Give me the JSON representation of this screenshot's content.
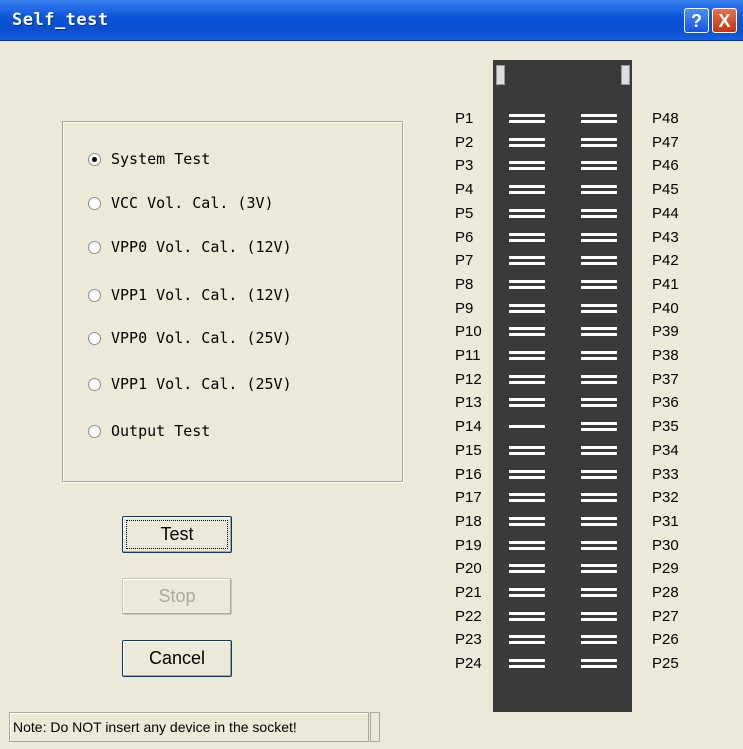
{
  "window": {
    "title": "Self_test",
    "help_label": "?",
    "close_label": "X"
  },
  "options": [
    {
      "label": "System Test",
      "checked": true
    },
    {
      "label": "VCC Vol. Cal. (3V)",
      "checked": false
    },
    {
      "label": "VPP0 Vol. Cal. (12V)",
      "checked": false
    },
    {
      "label": "VPP1 Vol. Cal. (12V)",
      "checked": false
    },
    {
      "label": "VPP0 Vol. Cal. (25V)",
      "checked": false
    },
    {
      "label": "VPP1 Vol. Cal. (25V)",
      "checked": false
    },
    {
      "label": "Output Test",
      "checked": false
    }
  ],
  "buttons": {
    "test": "Test",
    "stop": "Stop",
    "cancel": "Cancel"
  },
  "socket": {
    "left_pins": [
      "P1",
      "P2",
      "P3",
      "P4",
      "P5",
      "P6",
      "P7",
      "P8",
      "P9",
      "P10",
      "P11",
      "P12",
      "P13",
      "P14",
      "P15",
      "P16",
      "P17",
      "P18",
      "P19",
      "P20",
      "P21",
      "P22",
      "P23",
      "P24"
    ],
    "right_pins": [
      "P48",
      "P47",
      "P46",
      "P45",
      "P44",
      "P43",
      "P42",
      "P41",
      "P40",
      "P39",
      "P38",
      "P37",
      "P36",
      "P35",
      "P34",
      "P33",
      "P32",
      "P31",
      "P30",
      "P29",
      "P28",
      "P27",
      "P26",
      "P25"
    ]
  },
  "status": {
    "note": "Note: Do NOT insert any device in the socket!"
  }
}
